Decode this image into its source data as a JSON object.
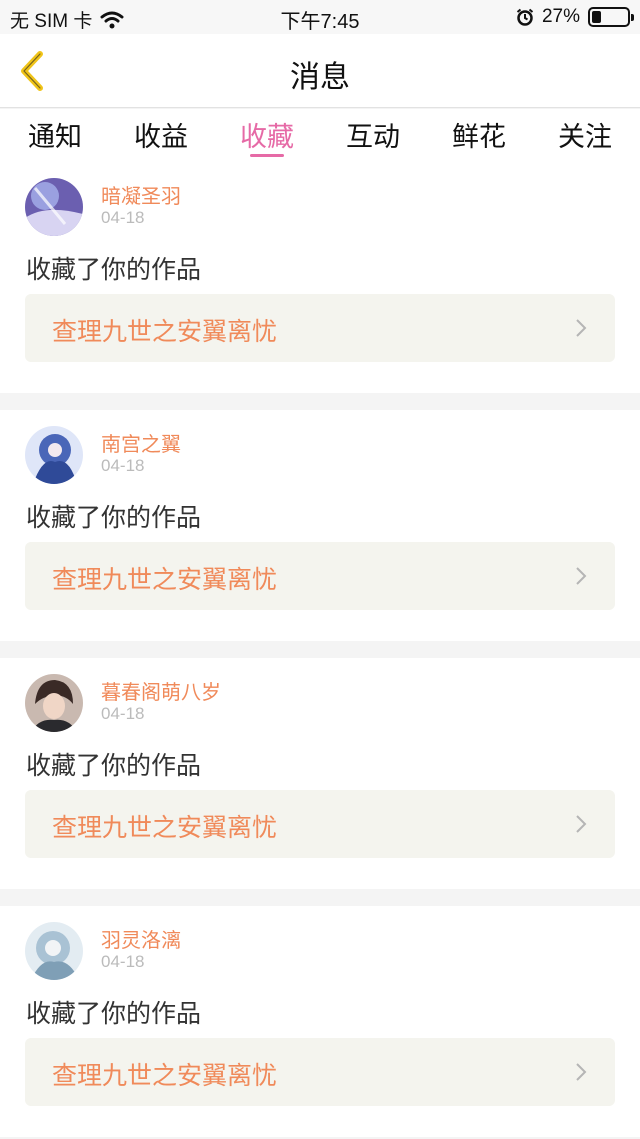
{
  "status_bar": {
    "carrier": "无 SIM 卡",
    "time": "下午7:45",
    "battery_percent": "27%",
    "battery_level": 0.27,
    "icons": [
      "wifi-icon",
      "alarm-icon",
      "battery-icon"
    ]
  },
  "nav": {
    "title": "消息",
    "back_icon": "chevron-left-icon",
    "back_color": "#f0c419"
  },
  "tabs": [
    {
      "label": "通知"
    },
    {
      "label": "收益"
    },
    {
      "label": "收藏"
    },
    {
      "label": "互动"
    },
    {
      "label": "鲜花"
    },
    {
      "label": "关注"
    }
  ],
  "active_tab": 2,
  "colors": {
    "accent": "#e66aa6",
    "name": "#f08a5a"
  },
  "messages": [
    {
      "name": "暗凝圣羽",
      "date": "04-18",
      "action": "收藏了你的作品",
      "work": "查理九世之安翼离忧"
    },
    {
      "name": "南宫之翼",
      "date": "04-18",
      "action": "收藏了你的作品",
      "work": "查理九世之安翼离忧"
    },
    {
      "name": "暮春阁萌八岁",
      "date": "04-18",
      "action": "收藏了你的作品",
      "work": "查理九世之安翼离忧"
    },
    {
      "name": "羽灵洛漓",
      "date": "04-18",
      "action": "收藏了你的作品",
      "work": "查理九世之安翼离忧"
    }
  ]
}
